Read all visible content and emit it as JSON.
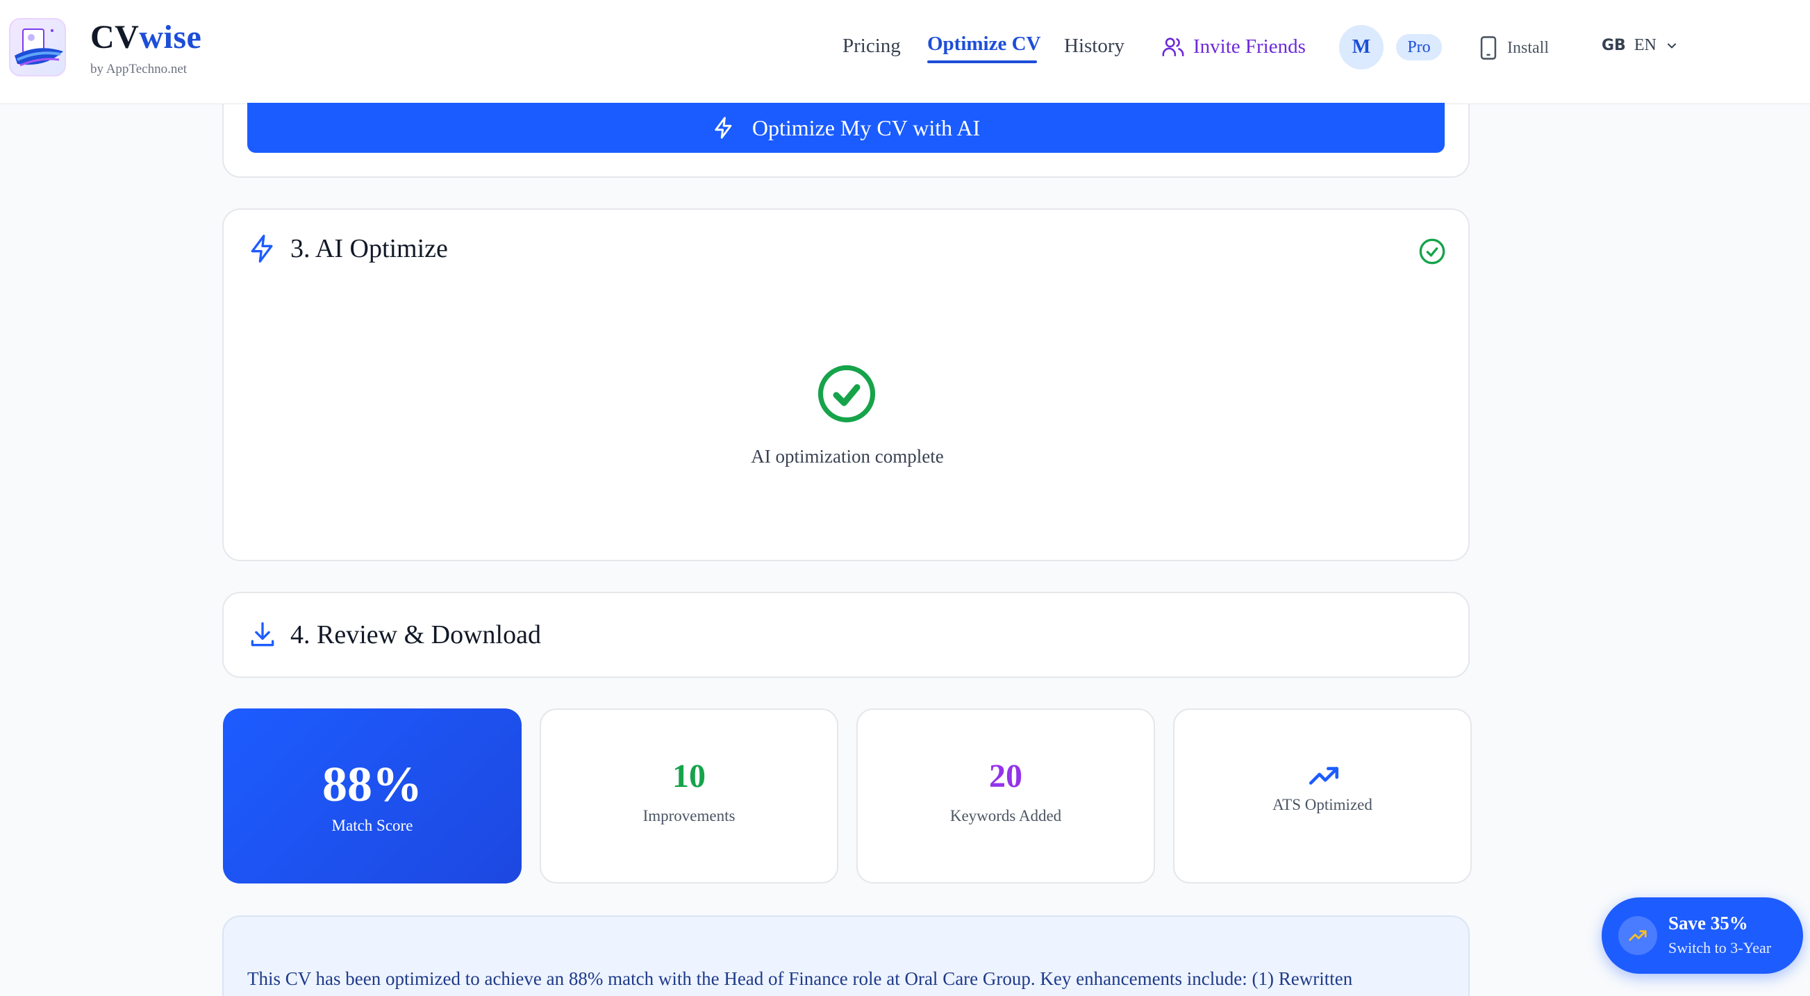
{
  "header": {
    "brand_part1": "CV",
    "brand_part2": "wise",
    "brand_sub": "by AppTechno.net",
    "nav": {
      "pricing": "Pricing",
      "optimize": "Optimize CV",
      "history": "History",
      "invite": "Invite Friends"
    },
    "avatar_initial": "M",
    "plan_badge": "Pro",
    "install": "Install",
    "lang_flag": "GB",
    "lang_code": "EN"
  },
  "cta": {
    "label": "Optimize My CV with AI"
  },
  "ai_section": {
    "title": "3. AI Optimize",
    "status_text": "AI optimization complete"
  },
  "review_section": {
    "title": "4. Review & Download"
  },
  "stats": {
    "match_value": "88%",
    "match_label": "Match Score",
    "improvements_value": "10",
    "improvements_label": "Improvements",
    "keywords_value": "20",
    "keywords_label": "Keywords Added",
    "ats_label": "ATS Optimized"
  },
  "summary": {
    "text": "This CV has been optimized to achieve an 88% match with the Head of Finance role at Oral Care Group. Key enhancements include: (1) Rewritten"
  },
  "promo": {
    "title": "Save 35%",
    "subtitle": "Switch to 3-Year"
  },
  "colors": {
    "primary": "#1a5cff",
    "success": "#16a34a",
    "keywords": "#9333ea",
    "invite": "#6d28d9"
  }
}
